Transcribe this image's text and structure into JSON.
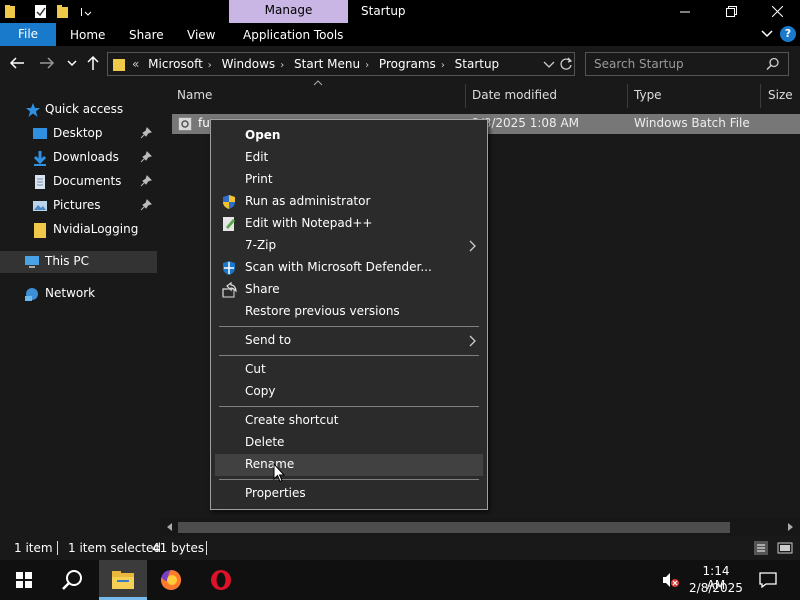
{
  "window": {
    "title": "Startup",
    "contextual_tab": "Manage"
  },
  "ribbon": {
    "tabs": [
      "File",
      "Home",
      "Share",
      "View",
      "Application Tools"
    ]
  },
  "address": {
    "overflow": "«",
    "crumbs": [
      "Microsoft",
      "Windows",
      "Start Menu",
      "Programs",
      "Startup"
    ]
  },
  "search": {
    "placeholder": "Search Startup"
  },
  "nav": {
    "items": [
      {
        "label": "Quick access",
        "icon": "star-icon"
      },
      {
        "label": "Desktop",
        "icon": "desktop-icon"
      },
      {
        "label": "Downloads",
        "icon": "download-icon"
      },
      {
        "label": "Documents",
        "icon": "documents-icon"
      },
      {
        "label": "Pictures",
        "icon": "pictures-icon"
      },
      {
        "label": "NvidiaLogging",
        "icon": "folder-icon"
      },
      {
        "label": "This PC",
        "icon": "computer-icon"
      },
      {
        "label": "Network",
        "icon": "network-icon"
      }
    ]
  },
  "columns": [
    "Name",
    "Date modified",
    "Type",
    "Size"
  ],
  "files": [
    {
      "name": "fu",
      "date": "2/8/2025 1:08 AM",
      "type": "Windows Batch File"
    }
  ],
  "context_menu": {
    "items": [
      "Open",
      "Edit",
      "Print",
      "Run as administrator",
      "Edit with Notepad++",
      "7-Zip",
      "Scan with Microsoft Defender...",
      "Share",
      "Restore previous versions",
      "Send to",
      "Cut",
      "Copy",
      "Create shortcut",
      "Delete",
      "Rename",
      "Properties"
    ]
  },
  "status": {
    "count": "1 item",
    "selected": "1 item selected",
    "size": "41 bytes"
  },
  "taskbar": {
    "time": "1:14 AM",
    "date": "2/8/2025"
  },
  "colors": {
    "accent": "#1979ca",
    "manage_tab": "#c9b6e4",
    "background": "#191919"
  }
}
